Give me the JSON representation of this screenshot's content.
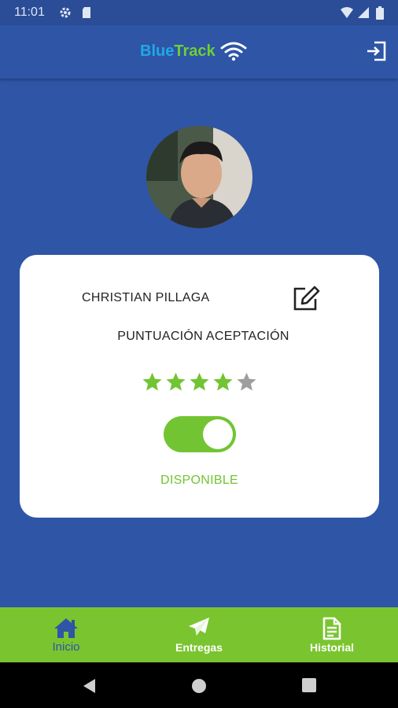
{
  "status_bar": {
    "time": "11:01"
  },
  "app_bar": {
    "brand_part1": "Blue",
    "brand_part2": "Track",
    "brand_icon": "wifi-icon",
    "logout_icon": "logout-icon"
  },
  "profile": {
    "avatar_icon": "avatar-photo",
    "name": "CHRISTIAN PILLAGA",
    "edit_icon": "edit-icon",
    "score_label": "PUNTUACIÓN ACEPTACIÓN",
    "rating": 4,
    "rating_max": 5,
    "available": true,
    "availability_label": "DISPONIBLE"
  },
  "bottom_nav": [
    {
      "label": "Inicio",
      "icon": "home-icon",
      "active": true
    },
    {
      "label": "Entregas",
      "icon": "send-icon",
      "active": false
    },
    {
      "label": "Historial",
      "icon": "document-icon",
      "active": false
    }
  ],
  "colors": {
    "primary": "#2e55a6",
    "accent_green": "#72c433",
    "nav_green": "#7ac52f",
    "brand_blue": "#1fa8e6",
    "star_off": "#9e9e9e"
  }
}
